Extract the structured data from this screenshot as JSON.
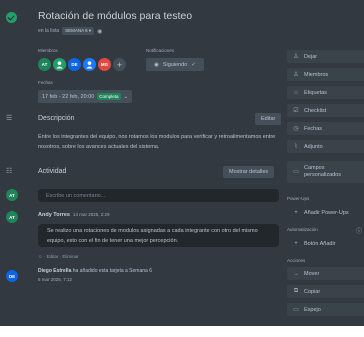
{
  "card": {
    "title": "Rotación de módulos para testeo",
    "in_list_prefix": "en la lista",
    "list_name": "SEMANA 6"
  },
  "members": {
    "label": "Miembros",
    "avatars": [
      {
        "initials": "AT",
        "color": "#1f845a"
      },
      {
        "initials": "",
        "color": "#22a06b"
      },
      {
        "initials": "DE",
        "color": "#0c66e4"
      },
      {
        "initials": "",
        "color": "#1d7afc"
      },
      {
        "initials": "MG",
        "color": "#e2483d"
      }
    ],
    "add_symbol": "+"
  },
  "notifications": {
    "label": "Notificaciones",
    "button": "Siguiendo"
  },
  "dates": {
    "label": "Fechas",
    "value": "17 feb - 22 feb, 20:00",
    "status": "Completa"
  },
  "description": {
    "title": "Descripción",
    "edit_button": "Editar",
    "text": "Entre los integrantes del equipo, nos rotamos los modulos para verificar y retroalimentamos entre nosotros, sobre los avances actuales del sistema."
  },
  "activity": {
    "title": "Actividad",
    "show_details": "Mostrar detalles",
    "comment_placeholder": "Escribe un comentario...",
    "current_user_initials": "AT",
    "entries": [
      {
        "author": "Andy Torres",
        "time": "14 mar 2025, 2:29",
        "initials": "AT",
        "text": "Se realizo una rotaciones de modulos asignadas a cada integrante con otro del mismo equipo, esto con el fin de tener una mejor percepción.",
        "actions": "☺ · Editar · Eliminar"
      },
      {
        "author": "Diego Estrella",
        "action": "ha añadido esta tarjeta a Semana 6",
        "time": "6 mar 2025, 7:12",
        "initials": "DE"
      }
    ]
  },
  "sidebar": {
    "main": [
      "Dejar",
      "Miembros",
      "Etiquetas",
      "Checklist",
      "Fechas",
      "Adjunto",
      "Campos personalizados"
    ],
    "powerups_label": "Power-Ups",
    "powerups_add": "Añadir Power-Ups",
    "automation_label": "Automatización",
    "automation_add": "Botón Añadir",
    "actions_label": "Acciones",
    "actions": [
      "Mover",
      "Copiar",
      "Espejo"
    ]
  },
  "colors": {
    "panel": "#323940",
    "accent_green": "#22a06b",
    "status_complete": "#1f845a"
  }
}
